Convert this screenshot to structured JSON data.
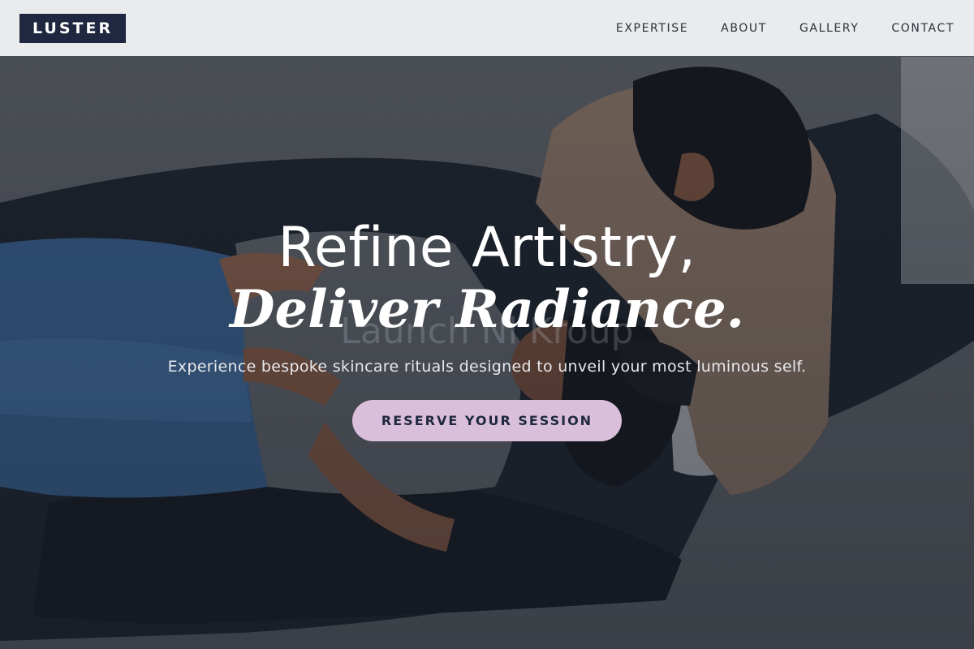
{
  "brand": {
    "logo_text": "LUSTER"
  },
  "nav": {
    "items": [
      {
        "label": "EXPERTISE"
      },
      {
        "label": "ABOUT"
      },
      {
        "label": "GALLERY"
      },
      {
        "label": "CONTACT"
      }
    ]
  },
  "hero": {
    "headline_line1": "Refine Artistry,",
    "headline_line2": "Deliver Radiance.",
    "watermark_text": "Launch Nl Kroup",
    "subheadline": "Experience bespoke skincare rituals designed to unveil your most luminous self.",
    "cta_label": "RESERVE YOUR SESSION"
  },
  "colors": {
    "logo_bg": "#1f2840",
    "cta_bg": "#d9bfdc",
    "nav_bg": "#f0f1f3"
  }
}
